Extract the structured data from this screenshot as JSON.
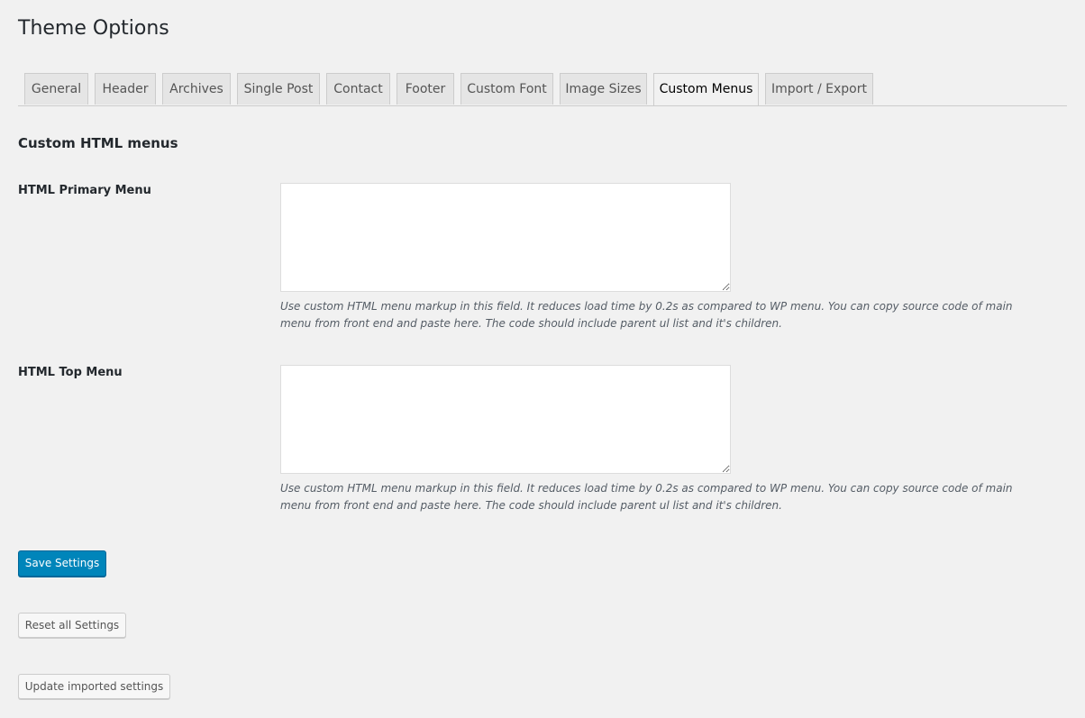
{
  "page": {
    "title": "Theme Options"
  },
  "tabs": [
    {
      "label": "General",
      "active": false
    },
    {
      "label": "Header",
      "active": false
    },
    {
      "label": "Archives",
      "active": false
    },
    {
      "label": "Single Post",
      "active": false
    },
    {
      "label": "Contact",
      "active": false
    },
    {
      "label": "Footer",
      "active": false
    },
    {
      "label": "Custom Font",
      "active": false
    },
    {
      "label": "Image Sizes",
      "active": false
    },
    {
      "label": "Custom Menus",
      "active": true
    },
    {
      "label": "Import / Export",
      "active": false
    }
  ],
  "section": {
    "title": "Custom HTML menus"
  },
  "fields": [
    {
      "label": "HTML Primary Menu",
      "value": "",
      "description": "Use custom HTML menu markup in this field. It reduces load time by 0.2s as compared to WP menu. You can copy source code of main menu from front end and paste here. The code should include parent ul list and it's children."
    },
    {
      "label": "HTML Top Menu",
      "value": "",
      "description": "Use custom HTML menu markup in this field. It reduces load time by 0.2s as compared to WP menu. You can copy source code of main menu from front end and paste here. The code should include parent ul list and it's children."
    }
  ],
  "buttons": {
    "save": "Save Settings",
    "reset": "Reset all Settings",
    "update_imported": "Update imported settings"
  },
  "colors": {
    "background": "#f1f1f1",
    "primary_button": "#0085ba",
    "tab_inactive": "#e5e5e5",
    "text": "#23282d",
    "description": "#555d66"
  }
}
